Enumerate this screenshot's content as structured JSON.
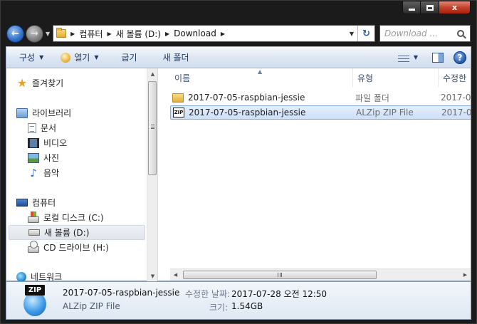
{
  "window": {
    "close_glyph": "x"
  },
  "address": {
    "crumbs": [
      "컴퓨터",
      "새 볼륨 (D:)",
      "Download"
    ],
    "search_placeholder": "Download ..."
  },
  "toolbar": {
    "organize": "구성",
    "open": "열기",
    "burn": "굽기",
    "new_folder": "새 폴더",
    "help": "?"
  },
  "nav": {
    "favorites": "즐겨찾기",
    "libraries": "라이브러리",
    "documents": "문서",
    "videos": "비디오",
    "pictures": "사진",
    "music": "음악",
    "computer": "컴퓨터",
    "local_disk": "로컬 디스크 (C:)",
    "new_volume": "새 볼륨 (D:)",
    "cd_drive": "CD 드라이브 (H:)",
    "network": "네트워크"
  },
  "columns": {
    "name": "이름",
    "type": "유형",
    "modified": "수정한"
  },
  "files": [
    {
      "name": "2017-07-05-raspbian-jessie",
      "type": "파일 폴더",
      "date": "2017-0",
      "icon": "folder-icon"
    },
    {
      "name": "2017-07-05-raspbian-jessie",
      "type": "ALZip ZIP File",
      "date": "2017-0",
      "icon": "zip-icon"
    }
  ],
  "details": {
    "icon_text": "ZIP",
    "name": "2017-07-05-raspbian-jessie",
    "type": "ALZip ZIP File",
    "modified_label": "수정한 날짜:",
    "modified_value": "2017-07-28 오전 12:50",
    "size_label": "크기:",
    "size_value": "1.54GB"
  }
}
